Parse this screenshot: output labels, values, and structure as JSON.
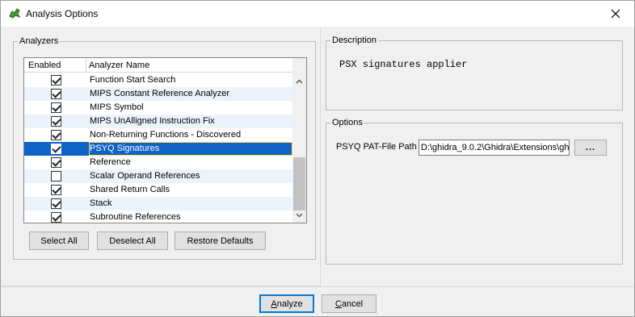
{
  "window": {
    "title": "Analysis Options",
    "close_glyph": "✕"
  },
  "analyzers": {
    "group_label": "Analyzers",
    "columns": {
      "enabled": "Enabled",
      "name": "Analyzer Name"
    },
    "rows": [
      {
        "name": "Function Start Search",
        "enabled": true,
        "selected": false
      },
      {
        "name": "MIPS Constant Reference Analyzer",
        "enabled": true,
        "selected": false
      },
      {
        "name": "MIPS Symbol",
        "enabled": true,
        "selected": false
      },
      {
        "name": "MIPS UnAlligned Instruction Fix",
        "enabled": true,
        "selected": false
      },
      {
        "name": "Non-Returning Functions - Discovered",
        "enabled": true,
        "selected": false
      },
      {
        "name": "PSYQ Signatures",
        "enabled": true,
        "selected": true
      },
      {
        "name": "Reference",
        "enabled": true,
        "selected": false
      },
      {
        "name": "Scalar Operand References",
        "enabled": false,
        "selected": false
      },
      {
        "name": "Shared Return Calls",
        "enabled": true,
        "selected": false
      },
      {
        "name": "Stack",
        "enabled": true,
        "selected": false
      },
      {
        "name": "Subroutine References",
        "enabled": true,
        "selected": false
      }
    ],
    "buttons": {
      "select_all": "Select All",
      "deselect_all": "Deselect All",
      "restore_defaults": "Restore Defaults"
    }
  },
  "description": {
    "group_label": "Description",
    "text": "PSX signatures applier"
  },
  "options": {
    "group_label": "Options",
    "pat_label": "PSYQ PAT-File Path",
    "pat_value": "D:\\ghidra_9.0.2\\Ghidra\\Extensions\\gh",
    "browse_label": "..."
  },
  "footer": {
    "analyze_first": "A",
    "analyze_rest": "nalyze",
    "cancel_first": "C",
    "cancel_rest": "ancel"
  },
  "colors": {
    "selection": "#0f62c6",
    "selection_border": "#ffd94a",
    "row_alt": "#ecf3fb",
    "default_button_border": "#0078d7"
  }
}
